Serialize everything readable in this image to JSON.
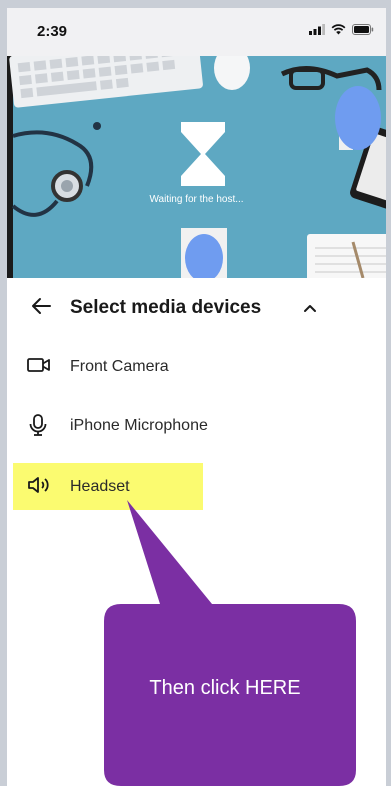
{
  "status_bar": {
    "time": "2:39"
  },
  "hero": {
    "waiting_text": "Waiting for the host..."
  },
  "panel": {
    "title": "Select media devices"
  },
  "devices": [
    {
      "label": "Front Camera",
      "icon": "camera-icon"
    },
    {
      "label": "iPhone Microphone",
      "icon": "microphone-icon"
    },
    {
      "label": "Headset",
      "icon": "speaker-icon"
    }
  ],
  "annotation": {
    "text": "Then click HERE",
    "highlight_color": "#fbfb70",
    "callout_color": "#7b2fa3"
  }
}
